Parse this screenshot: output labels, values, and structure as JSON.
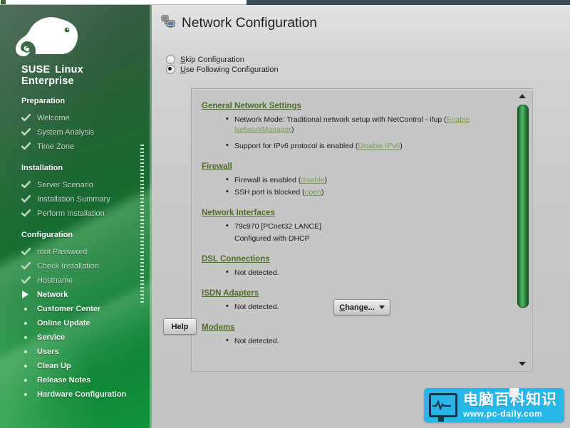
{
  "window": {
    "titlebar_icon": "suse-window-icon"
  },
  "sidebar": {
    "brand_line1": "SUSE",
    "brand_reg": ".",
    "brand_line1b": "Linux",
    "brand_line2": "Enterprise",
    "logo_icon": "suse-chameleon-logo",
    "groups": [
      {
        "title": "Preparation",
        "items": [
          {
            "label": "Welcome",
            "state": "done",
            "marker": "check-icon"
          },
          {
            "label": "System Analysis",
            "state": "done",
            "marker": "check-icon"
          },
          {
            "label": "Time Zone",
            "state": "done",
            "marker": "check-icon"
          }
        ]
      },
      {
        "title": "Installation",
        "items": [
          {
            "label": "Server Scenario",
            "state": "done",
            "marker": "check-icon"
          },
          {
            "label": "Installation Summary",
            "state": "done",
            "marker": "check-icon"
          },
          {
            "label": "Perform Installation",
            "state": "done",
            "marker": "check-icon"
          }
        ]
      },
      {
        "title": "Configuration",
        "items": [
          {
            "label": "root Password",
            "state": "done",
            "marker": "check-icon"
          },
          {
            "label": "Check Installation",
            "state": "done",
            "marker": "check-icon"
          },
          {
            "label": "Hostname",
            "state": "done",
            "marker": "check-icon"
          },
          {
            "label": "Network",
            "state": "current",
            "marker": "arrow-right-icon"
          },
          {
            "label": "Customer Center",
            "state": "todo",
            "marker": "bullet-icon"
          },
          {
            "label": "Online Update",
            "state": "todo",
            "marker": "bullet-icon"
          },
          {
            "label": "Service",
            "state": "todo",
            "marker": "bullet-icon"
          },
          {
            "label": "Users",
            "state": "todo",
            "marker": "bullet-icon"
          },
          {
            "label": "Clean Up",
            "state": "todo",
            "marker": "bullet-icon"
          },
          {
            "label": "Release Notes",
            "state": "todo",
            "marker": "bullet-icon"
          },
          {
            "label": "Hardware Configuration",
            "state": "todo",
            "marker": "bullet-icon"
          }
        ]
      }
    ]
  },
  "header": {
    "icon": "network-configuration-icon",
    "title": "Network Configuration"
  },
  "mode_options": [
    {
      "label_pre": "",
      "accel": "S",
      "label_post": "kip Configuration",
      "selected": false,
      "name": "skip-configuration"
    },
    {
      "label_pre": "",
      "accel": "U",
      "label_post": "se Following Configuration",
      "selected": true,
      "name": "use-following-configuration"
    }
  ],
  "summary": {
    "sections": [
      {
        "heading": "General Network Settings",
        "lines": [
          {
            "text": "Network Mode: Traditional network setup with NetControl - ifup (",
            "link": "Enable NetworkManager",
            "tail": ")",
            "spaced": true
          },
          {
            "text": "Support for IPv6 protocol is enabled (",
            "link": "Disable IPv6",
            "tail": ")",
            "spaced": false
          }
        ]
      },
      {
        "heading": "Firewall",
        "lines": [
          {
            "text": "Firewall is enabled (",
            "link": "disable",
            "tail": ")",
            "spaced": false
          },
          {
            "text": "SSH port is blocked (",
            "link": "open",
            "tail": ")",
            "spaced": false
          }
        ]
      },
      {
        "heading": "Network Interfaces",
        "lines": [
          {
            "text": "79c970 [PCnet32 LANCE]",
            "link": "",
            "tail": "",
            "spaced": false
          },
          {
            "text": "Configured with DHCP",
            "link": "",
            "tail": "",
            "bulletless": true,
            "spaced": false
          }
        ]
      },
      {
        "heading": "DSL Connections",
        "lines": [
          {
            "text": "Not detected.",
            "link": "",
            "tail": "",
            "spaced": false
          }
        ]
      },
      {
        "heading": "ISDN Adapters",
        "lines": [
          {
            "text": "Not detected.",
            "link": "",
            "tail": "",
            "spaced": false
          }
        ]
      },
      {
        "heading": "Modems",
        "lines": [
          {
            "text": "Not detected.",
            "link": "",
            "tail": "",
            "spaced": false
          }
        ]
      }
    ]
  },
  "scrollbar": {
    "up_icon": "scroll-up-arrow-icon",
    "down_icon": "scroll-down-arrow-icon",
    "thumb": "scrollbar-thumb"
  },
  "buttons": {
    "change_accel": "C",
    "change_label": "hange...",
    "change_caret": "chevron-down-icon",
    "help_label": "Help"
  },
  "watermark": {
    "monitor_icon": "monitor-pulse-icon",
    "chinese": "电脑百科知识",
    "url": "www.pc-daily.com"
  },
  "colors": {
    "suse_green": "#176a32",
    "link_green": "#7b9b55",
    "heading_green": "#4e6b28",
    "panel_bg": "#c6c6c6",
    "watermark_blue": "#27b6e8"
  }
}
